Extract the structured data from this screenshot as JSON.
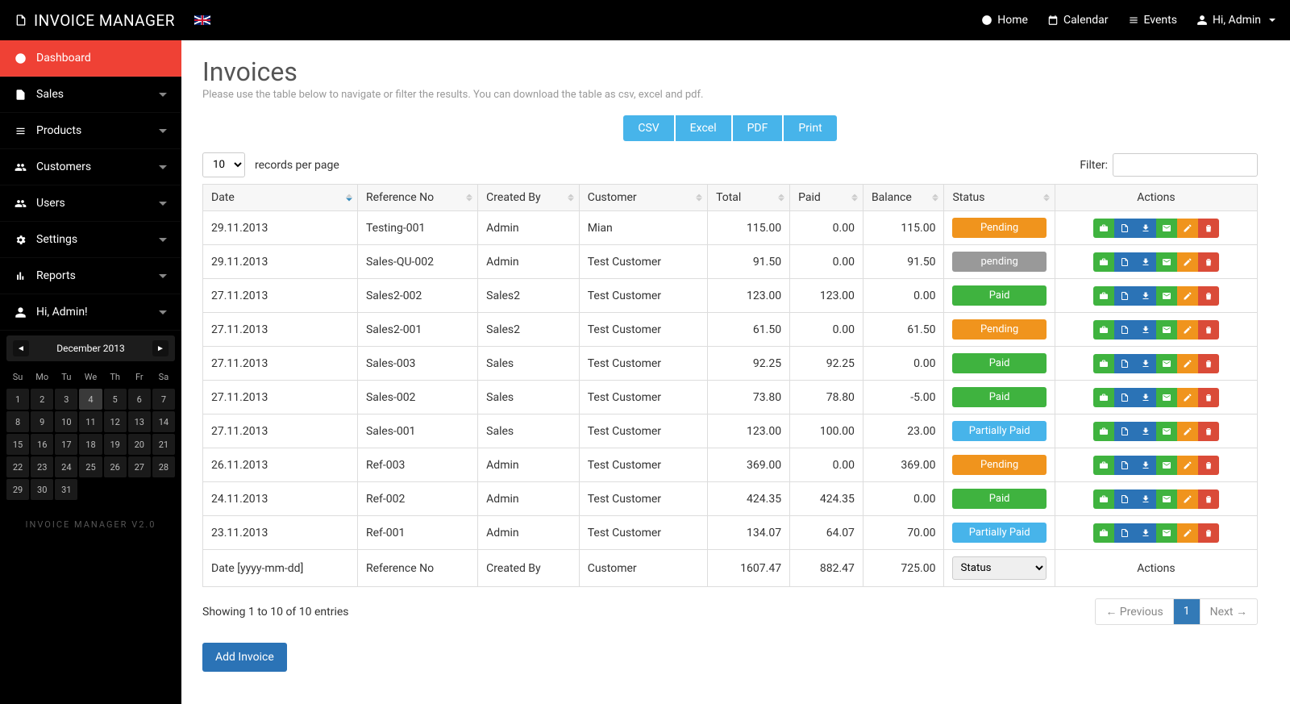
{
  "brand": "INVOICE MANAGER",
  "topnav": {
    "home": "Home",
    "calendar": "Calendar",
    "events": "Events",
    "user": "Hi, Admin"
  },
  "sidebar": {
    "items": [
      {
        "label": "Dashboard"
      },
      {
        "label": "Sales"
      },
      {
        "label": "Products"
      },
      {
        "label": "Customers"
      },
      {
        "label": "Users"
      },
      {
        "label": "Settings"
      },
      {
        "label": "Reports"
      },
      {
        "label": "Hi, Admin!"
      }
    ],
    "footer": "INVOICE MANAGER V2.0"
  },
  "calendar": {
    "title": "December 2013",
    "dow": [
      "Su",
      "Mo",
      "Tu",
      "We",
      "Th",
      "Fr",
      "Sa"
    ],
    "days": [
      1,
      2,
      3,
      4,
      5,
      6,
      7,
      8,
      9,
      10,
      11,
      12,
      13,
      14,
      15,
      16,
      17,
      18,
      19,
      20,
      21,
      22,
      23,
      24,
      25,
      26,
      27,
      28,
      29,
      30,
      31
    ],
    "today": 4
  },
  "page": {
    "title": "Invoices",
    "subtitle": "Please use the table below to navigate or filter the results. You can download the table as csv, excel and pdf."
  },
  "export_buttons": [
    "CSV",
    "Excel",
    "PDF",
    "Print"
  ],
  "records": {
    "value": "10",
    "label": "records per page"
  },
  "filter_label": "Filter:",
  "columns": [
    "Date",
    "Reference No",
    "Created By",
    "Customer",
    "Total",
    "Paid",
    "Balance",
    "Status",
    "Actions"
  ],
  "rows": [
    {
      "date": "29.11.2013",
      "ref": "Testing-001",
      "by": "Admin",
      "cust": "Mian",
      "total": "115.00",
      "paid": "0.00",
      "bal": "115.00",
      "status": "Pending",
      "sc": "pending"
    },
    {
      "date": "29.11.2013",
      "ref": "Sales-QU-002",
      "by": "Admin",
      "cust": "Test Customer",
      "total": "91.50",
      "paid": "0.00",
      "bal": "91.50",
      "status": "pending",
      "sc": "gray"
    },
    {
      "date": "27.11.2013",
      "ref": "Sales2-002",
      "by": "Sales2",
      "cust": "Test Customer",
      "total": "123.00",
      "paid": "123.00",
      "bal": "0.00",
      "status": "Paid",
      "sc": "paid"
    },
    {
      "date": "27.11.2013",
      "ref": "Sales2-001",
      "by": "Sales2",
      "cust": "Test Customer",
      "total": "61.50",
      "paid": "0.00",
      "bal": "61.50",
      "status": "Pending",
      "sc": "pending"
    },
    {
      "date": "27.11.2013",
      "ref": "Sales-003",
      "by": "Sales",
      "cust": "Test Customer",
      "total": "92.25",
      "paid": "92.25",
      "bal": "0.00",
      "status": "Paid",
      "sc": "paid"
    },
    {
      "date": "27.11.2013",
      "ref": "Sales-002",
      "by": "Sales",
      "cust": "Test Customer",
      "total": "73.80",
      "paid": "78.80",
      "bal": "-5.00",
      "status": "Paid",
      "sc": "paid"
    },
    {
      "date": "27.11.2013",
      "ref": "Sales-001",
      "by": "Sales",
      "cust": "Test Customer",
      "total": "123.00",
      "paid": "100.00",
      "bal": "23.00",
      "status": "Partially Paid",
      "sc": "partial"
    },
    {
      "date": "26.11.2013",
      "ref": "Ref-003",
      "by": "Admin",
      "cust": "Test Customer",
      "total": "369.00",
      "paid": "0.00",
      "bal": "369.00",
      "status": "Pending",
      "sc": "pending"
    },
    {
      "date": "24.11.2013",
      "ref": "Ref-002",
      "by": "Admin",
      "cust": "Test Customer",
      "total": "424.35",
      "paid": "424.35",
      "bal": "0.00",
      "status": "Paid",
      "sc": "paid"
    },
    {
      "date": "23.11.2013",
      "ref": "Ref-001",
      "by": "Admin",
      "cust": "Test Customer",
      "total": "134.07",
      "paid": "64.07",
      "bal": "70.00",
      "status": "Partially Paid",
      "sc": "partial"
    }
  ],
  "totals": {
    "total": "1607.47",
    "paid": "882.47",
    "bal": "725.00"
  },
  "foot_inputs": {
    "date": "Date [yyyy-mm-dd]",
    "ref": "Reference No",
    "by": "Created By",
    "cust": "Customer",
    "status": "Status",
    "actions": "Actions"
  },
  "showing": "Showing 1 to 10 of 10 entries",
  "pager": {
    "prev": "← Previous",
    "page": "1",
    "next": "Next →"
  },
  "add_button": "Add Invoice"
}
